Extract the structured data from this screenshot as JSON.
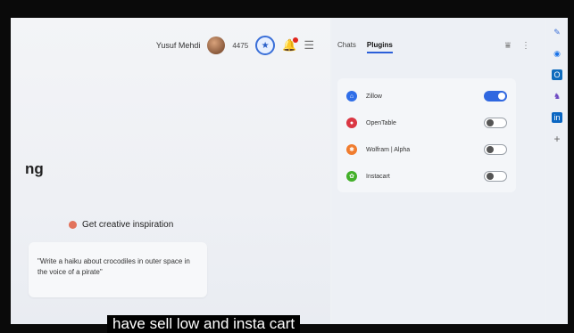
{
  "header": {
    "username": "Yusuf Mehdi",
    "points": "4475",
    "trophy_icon": "trophy-icon",
    "bell_icon": "bell-icon",
    "menu_icon": "hamburger-icon"
  },
  "main": {
    "heading_fragment": "ng",
    "suggestion_title": "Get creative inspiration",
    "suggestion_text": "\"Write a haiku about crocodiles in outer space in the voice of a pirate\""
  },
  "sidebar": {
    "tabs": [
      {
        "label": "Chats"
      },
      {
        "label": "Plugins"
      }
    ],
    "plugins": [
      {
        "name": "Zillow",
        "enabled": true,
        "color": "#2f6ee8"
      },
      {
        "name": "OpenTable",
        "enabled": false,
        "color": "#da3743"
      },
      {
        "name": "Wolfram | Alpha",
        "enabled": false,
        "color": "#f07c2e"
      },
      {
        "name": "Instacart",
        "enabled": false,
        "color": "#43b02a"
      }
    ]
  },
  "rail": {
    "icons": [
      "pencil-icon",
      "chrome-icon",
      "outlook-icon",
      "games-icon",
      "linkedin-icon",
      "add-icon"
    ]
  },
  "caption": "have sell low and insta cart"
}
